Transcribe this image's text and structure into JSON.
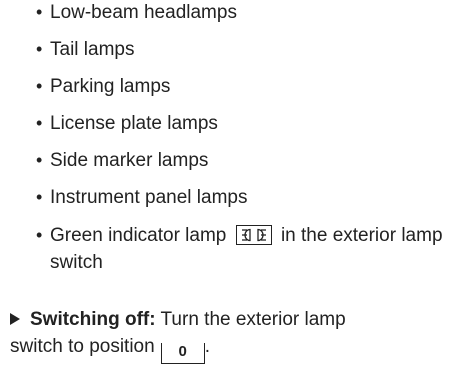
{
  "bullets": [
    "Low-beam headlamps",
    "Tail lamps",
    "Parking lamps",
    "License plate lamps",
    "Side marker lamps",
    "Instrument panel lamps"
  ],
  "last_bullet": {
    "before": "Green indicator lamp",
    "icon": "parking-lamp-icon",
    "after": "in the exterior lamp switch"
  },
  "step": {
    "label": "Switching off:",
    "text_line1": "Turn the exterior lamp",
    "text_line2": "switch to position",
    "position": "0",
    "text_end": "."
  },
  "colors": {
    "text": "#222222",
    "background": "#ffffff"
  }
}
